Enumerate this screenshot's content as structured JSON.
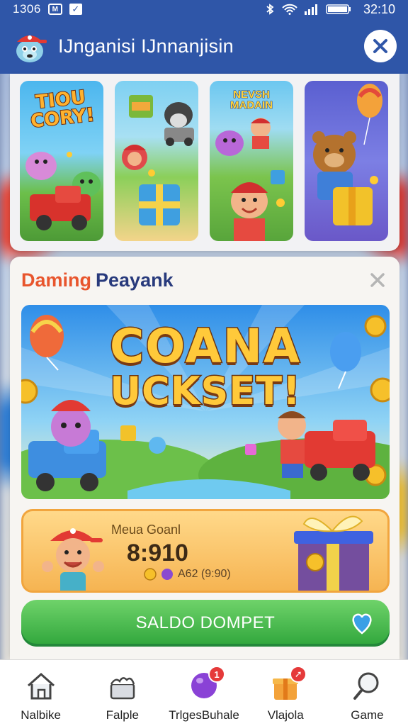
{
  "status_bar": {
    "time": "1306",
    "notif_badge": "M",
    "clock": "32:10",
    "icons": [
      "bluetooth-icon",
      "wifi-icon",
      "signal-icon",
      "battery-icon"
    ]
  },
  "header": {
    "title": "IJnganisi IJnnanjisin",
    "colors": {
      "bar": "#2f56a8"
    }
  },
  "game_cards": [
    {
      "label": "TIOU CORY!",
      "theme": "truck-pigs"
    },
    {
      "label": "",
      "theme": "boxes-robot"
    },
    {
      "label": "NEVSH MADAIN",
      "theme": "park-kids"
    },
    {
      "label": "",
      "theme": "bear-balloon"
    }
  ],
  "modal": {
    "title_part1": "Daming",
    "title_part2": "Peayank",
    "banner": {
      "line1": "COANA",
      "line2": "UCKSET!"
    },
    "reward": {
      "label": "Meua Goanl",
      "amount": "8:910",
      "sub": "A62 (9:90)"
    },
    "cta_label": "SALDO DOMPET",
    "colors": {
      "title_accent": "#e8552d",
      "title_main": "#283a7c",
      "cta": "#3bb145"
    }
  },
  "bottom_nav": [
    {
      "label": "Nalbike",
      "icon": "home-icon",
      "badge": ""
    },
    {
      "label": "Falple",
      "icon": "cake-icon",
      "badge": ""
    },
    {
      "label": "TrlgesBuhale",
      "icon": "balloon-icon",
      "badge": "1"
    },
    {
      "label": "Vlajola",
      "icon": "gift-box-icon",
      "badge": "arrow"
    },
    {
      "label": "Game",
      "icon": "search-icon",
      "badge": ""
    }
  ]
}
